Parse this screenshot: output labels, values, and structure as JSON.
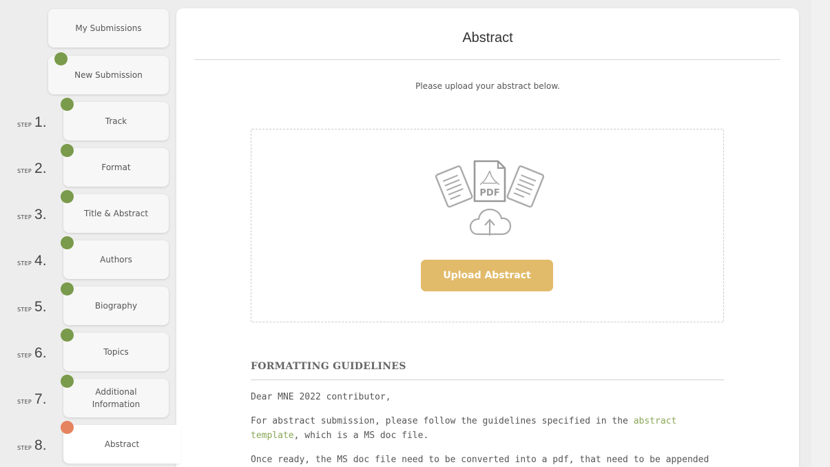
{
  "sidebar": {
    "my_submissions": "My Submissions",
    "new_submission": "New Submission",
    "step_word": "STEP",
    "steps": [
      {
        "number": "1.",
        "label": "Track"
      },
      {
        "number": "2.",
        "label": "Format"
      },
      {
        "number": "3.",
        "label": "Title & Abstract"
      },
      {
        "number": "4.",
        "label": "Authors"
      },
      {
        "number": "5.",
        "label": "Biography"
      },
      {
        "number": "6.",
        "label": "Topics"
      },
      {
        "number": "7.",
        "label": "Additional Information"
      },
      {
        "number": "8.",
        "label": "Abstract"
      }
    ],
    "completed_color": "#7a9a4c",
    "current_color": "#e5835e"
  },
  "main": {
    "title": "Abstract",
    "instruction": "Please upload your abstract below.",
    "upload": {
      "icon": "pdf-documents-upload-icon",
      "pdf_label": "PDF",
      "button_label": "Upload Abstract",
      "button_color": "#e2bb6a"
    },
    "guidelines": {
      "heading": "FORMATTING GUIDELINES",
      "greeting": "Dear MNE 2022 contributor,",
      "p2_before": "For abstract submission, please follow the guidelines specified in the ",
      "p2_link": "abstract template",
      "p2_after": ", which is a MS doc file.",
      "p3": "Once ready, the MS doc file need to be converted into a pdf, that need to be appended to",
      "link_color": "#8aa757"
    }
  }
}
